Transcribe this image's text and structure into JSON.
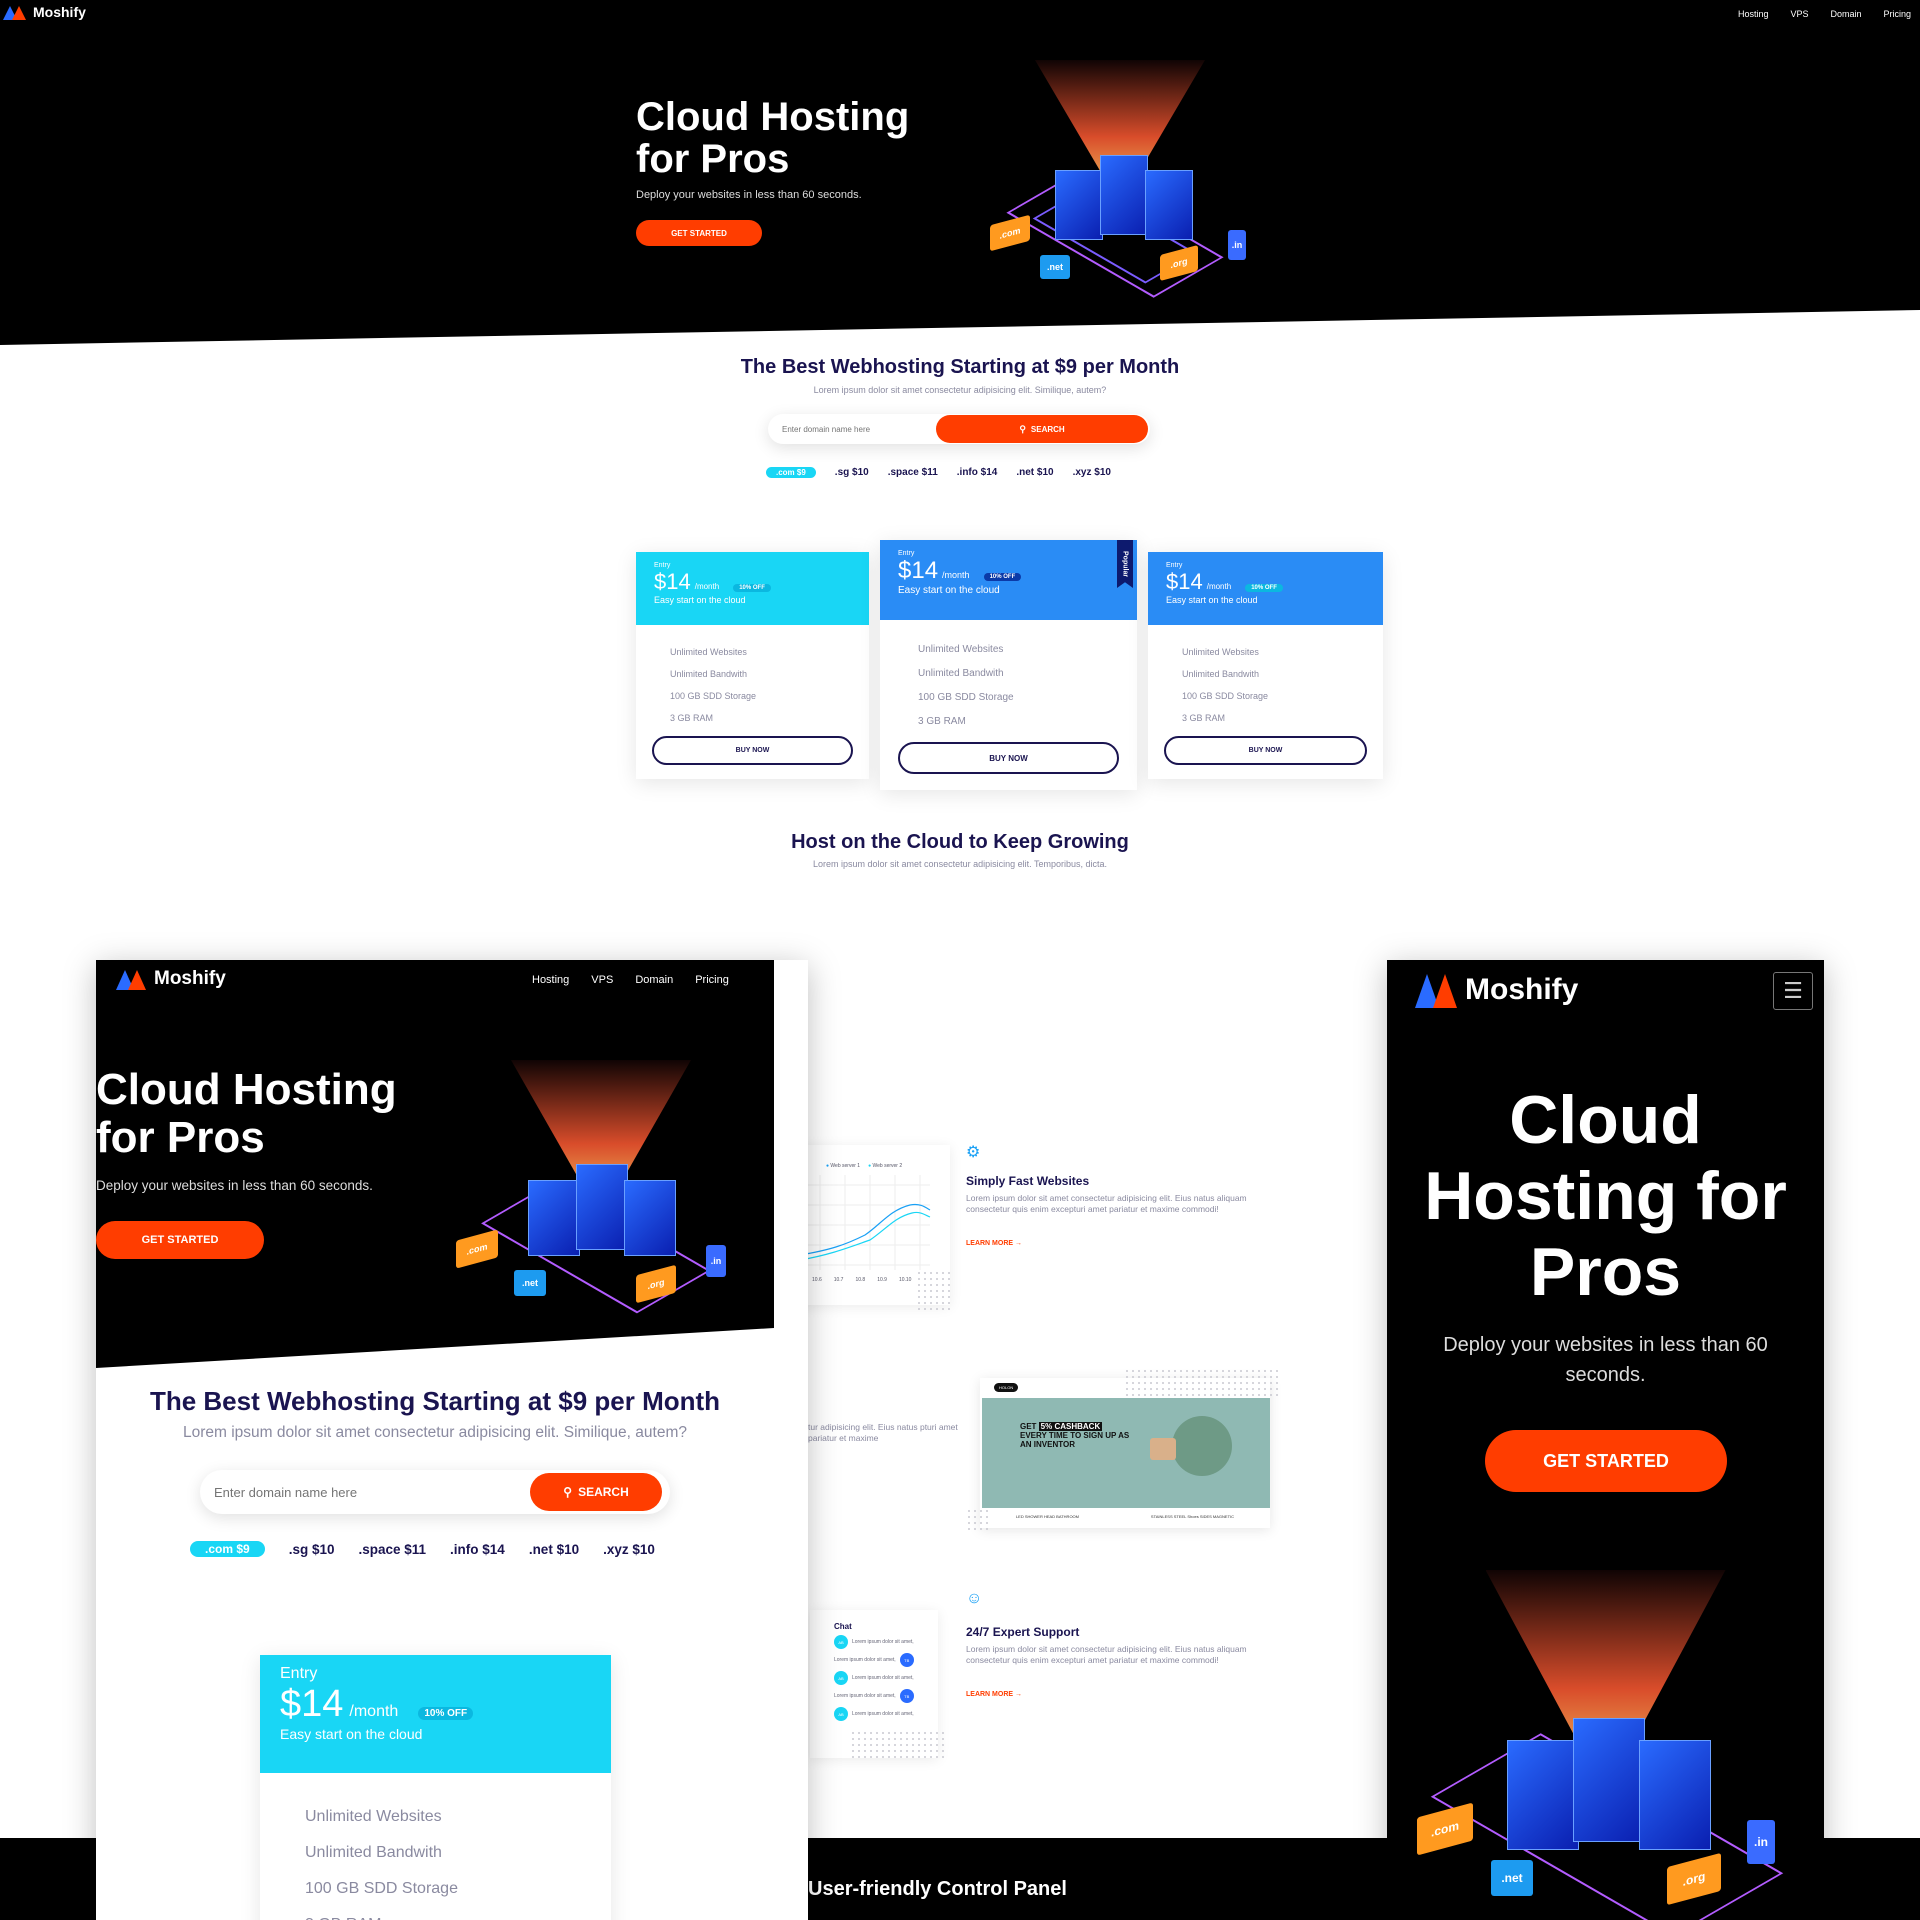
{
  "brand": {
    "name": "Moshify",
    "colors": {
      "accent": "#ff3d00",
      "cyan": "#19d6f5",
      "blue": "#2a8cf5",
      "navy": "#1a1450"
    }
  },
  "nav": {
    "items": [
      "Hosting",
      "VPS",
      "Domain",
      "Pricing"
    ]
  },
  "hero": {
    "title_line1": "Cloud Hosting",
    "title_line2": "for Pros",
    "subtitle": "Deploy your websites in less than 60 seconds.",
    "cta": "GET STARTED",
    "devices": [
      ".com",
      ".net",
      ".org",
      ".in"
    ]
  },
  "domain_search": {
    "title": "The Best Webhosting Starting at $9 per Month",
    "subtitle": "Lorem ipsum dolor sit amet consectetur adipisicing elit. Similique, autem?",
    "placeholder": "Enter domain name here",
    "button": "SEARCH",
    "tlds": [
      ".com $9",
      ".sg $10",
      ".space $11",
      ".info $14",
      ".net $10",
      ".xyz $10"
    ]
  },
  "pricing": {
    "plans": [
      {
        "tier": "Entry",
        "price": "$14",
        "period": "/month",
        "badge": "10% OFF",
        "tagline": "Easy start on the cloud",
        "features": [
          "Unlimited Websites",
          "Unlimited Bandwith",
          "100 GB SDD Storage",
          "3 GB RAM"
        ],
        "button": "BUY NOW",
        "color": "#19d6f5"
      },
      {
        "tier": "Entry",
        "price": "$14",
        "period": "/month",
        "badge": "10% OFF",
        "tagline": "Easy start on the cloud",
        "features": [
          "Unlimited Websites",
          "Unlimited Bandwith",
          "100 GB SDD Storage",
          "3 GB RAM"
        ],
        "button": "BUY NOW",
        "color": "#2a8cf5",
        "ribbon": "Popular"
      },
      {
        "tier": "Entry",
        "price": "$14",
        "period": "/month",
        "badge": "10% OFF",
        "tagline": "Easy start on the cloud",
        "features": [
          "Unlimited Websites",
          "Unlimited Bandwith",
          "100 GB SDD Storage",
          "3 GB RAM"
        ],
        "button": "BUY NOW",
        "color": "#2a8cf5"
      }
    ]
  },
  "growing": {
    "title": "Host on the Cloud to Keep Growing",
    "subtitle": "Lorem ipsum dolor sit amet consectetur adipisicing elit. Temporibus, dicta."
  },
  "features": [
    {
      "title": "Simply Fast Websites",
      "text": "Lorem ipsum dolor sit amet consectetur adipisicing elit. Eius natus aliquam consectetur quis enim excepturi amet pariatur et maxime commodi!",
      "link": "LEARN MORE →"
    },
    {
      "title": "",
      "text": "tur adipisicing elit. Eius natus pturi amet pariatur et maxime",
      "link": ""
    },
    {
      "title": "24/7 Expert Support",
      "text": "Lorem ipsum dolor sit amet consectetur adipisicing elit. Eius natus aliquam consectetur quis enim excepturi amet pariatur et maxime commodi!",
      "link": "LEARN MORE →"
    }
  ],
  "chart_card": {
    "legend": [
      "Web server 1",
      "Web server 2"
    ],
    "ticks": [
      "10.6",
      "10.7",
      "10.8",
      "10.9",
      "10.10"
    ]
  },
  "store_card": {
    "logo": "HOLON",
    "headline_prefix": "GET ",
    "headline_highlight": "5% CASHBACK",
    "headline_rest": "EVERY TIME TO SIGN UP AS AN INVENTOR",
    "captions": [
      "LED SHOWER HEAD BATHROOM",
      "STAINLESS STEEL Shoes SIDES MAGNETIC"
    ]
  },
  "chat_card": {
    "title": "Chat",
    "messages": [
      {
        "avatar": "AB",
        "text": "Lorem ipsum dolor sit amet,"
      },
      {
        "avatar": "TB",
        "text": "Lorem ipsum dolor sit amet,"
      },
      {
        "avatar": "AB",
        "text": "Lorem ipsum dolor sit amet,"
      },
      {
        "avatar": "TB",
        "text": "Lorem ipsum dolor sit amet,"
      },
      {
        "avatar": "AB",
        "text": "Lorem ipsum dolor sit amet,"
      }
    ]
  },
  "footer_band": {
    "title": "User-friendly Control Panel"
  },
  "mobile": {
    "title_line1": "Cloud",
    "title_line2": "Hosting for",
    "title_line3": "Pros",
    "subtitle": "Deploy your websites in less than 60 seconds.",
    "cta": "GET STARTED"
  }
}
